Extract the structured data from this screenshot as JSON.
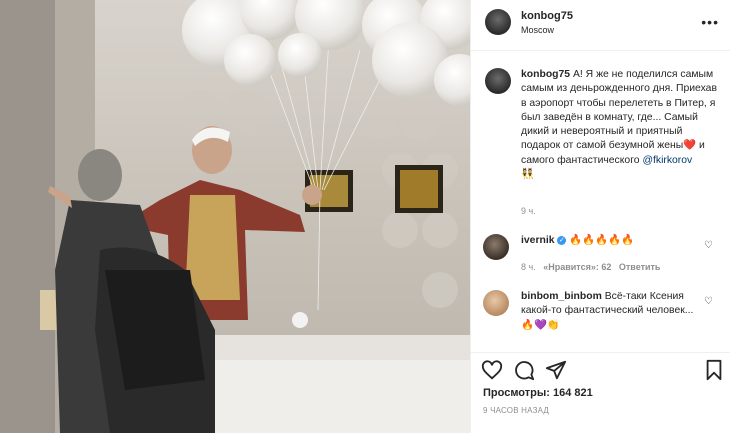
{
  "post": {
    "username": "konbog75",
    "location": "Moscow",
    "more_icon": "•••"
  },
  "caption": {
    "username": "konbog75",
    "text_1": "А! Я же не поделился самым самым из деньрожденного дня. Приехав в аэропорт чтобы перелететь в Питер, я был заведён в комнату, где... Самый дикий и невероятный и приятный подарок от самой безумной жены",
    "heart": "❤️",
    "text_2": "и самого фантастического",
    "mention": "@fkirkorov",
    "emoji_end": "👯",
    "time": "9 ч."
  },
  "comments": [
    {
      "username": "ivernik",
      "verified": "✓",
      "text": "🔥🔥🔥🔥🔥",
      "time": "8 ч.",
      "likes": "«Нравится»: 62",
      "reply": "Ответить"
    },
    {
      "username": "binbom_binbom",
      "text": "Всё-таки Ксения какой-то фантастический человек...🔥💜👏"
    }
  ],
  "stats": {
    "views": "Просмотры: 164 821",
    "posted": "9 ЧАСОВ НАЗАД"
  },
  "colors": {
    "link": "#00376b",
    "muted": "#8e8e8e",
    "text": "#262626",
    "border": "#efefef"
  },
  "icons": [
    "heart-icon",
    "comment-icon",
    "share-icon",
    "bookmark-icon",
    "like-comment-icon"
  ]
}
